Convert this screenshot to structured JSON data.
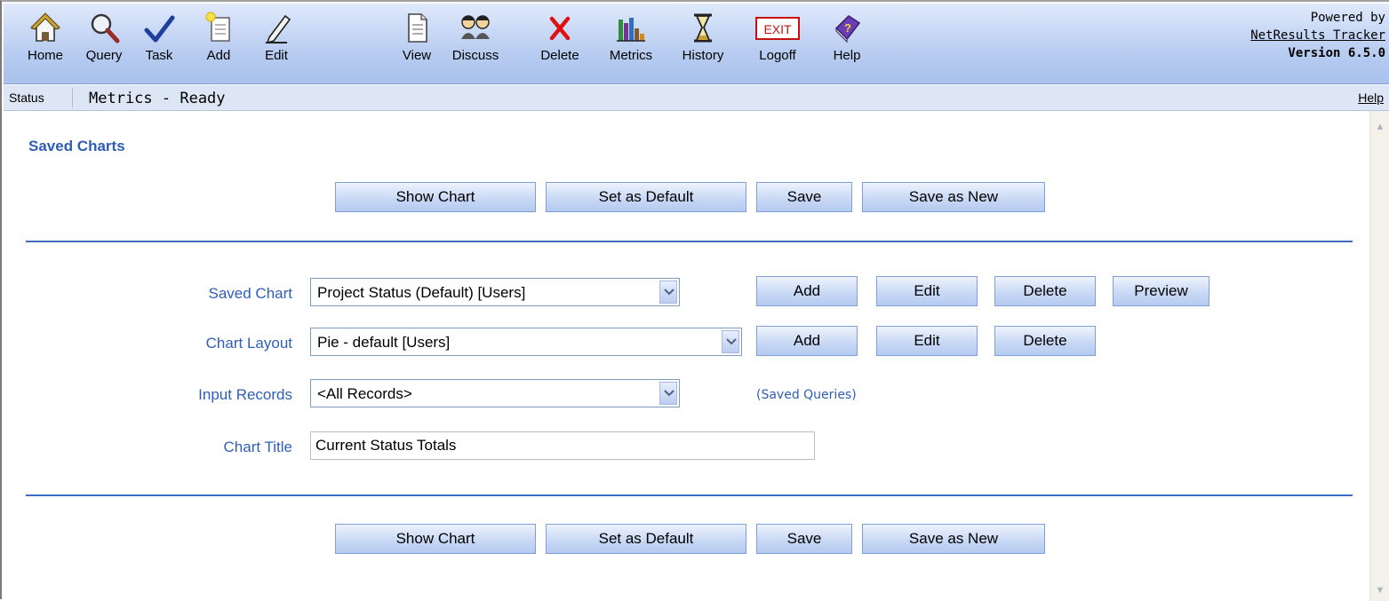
{
  "toolbar": {
    "items": [
      {
        "label": "Home",
        "icon": "home-icon"
      },
      {
        "label": "Query",
        "icon": "magnifier-icon"
      },
      {
        "label": "Task",
        "icon": "checkmark-icon"
      },
      {
        "label": "Add",
        "icon": "new-document-icon"
      },
      {
        "label": "Edit",
        "icon": "pencil-icon"
      },
      {
        "label": "View",
        "icon": "document-icon"
      },
      {
        "label": "Discuss",
        "icon": "people-icon"
      },
      {
        "label": "Delete",
        "icon": "red-x-icon"
      },
      {
        "label": "Metrics",
        "icon": "bar-chart-icon"
      },
      {
        "label": "History",
        "icon": "hourglass-icon"
      },
      {
        "label": "Logoff",
        "icon": "exit-sign-icon",
        "icon_text": "EXIT"
      },
      {
        "label": "Help",
        "icon": "help-book-icon",
        "icon_text": "?"
      }
    ],
    "powered_by": "Powered by",
    "product_link": "NetResults Tracker",
    "version": "Version 6.5.0"
  },
  "statusbar": {
    "label": "Status",
    "text": "Metrics - Ready",
    "help": "Help"
  },
  "main": {
    "section_title": "Saved Charts",
    "top_buttons": [
      "Show Chart",
      "Set as Default",
      "Save",
      "Save as New"
    ],
    "bottom_buttons": [
      "Show Chart",
      "Set as Default",
      "Save",
      "Save as New"
    ],
    "saved_chart": {
      "label": "Saved Chart",
      "value": "Project Status (Default) [Users]",
      "buttons": [
        "Add",
        "Edit",
        "Delete",
        "Preview"
      ]
    },
    "chart_layout": {
      "label": "Chart Layout",
      "value": "Pie - default [Users]",
      "buttons": [
        "Add",
        "Edit",
        "Delete"
      ]
    },
    "input_records": {
      "label": "Input Records",
      "value": "<All Records>",
      "link": "(Saved Queries)"
    },
    "chart_title": {
      "label": "Chart Title",
      "value": "Current Status Totals"
    }
  },
  "colors": {
    "accent": "#2e5eb8",
    "toolbar_bg": "#b9cdf1",
    "rule": "#3d6cc0",
    "button_bg": "#c9d9f5",
    "delete_red": "#e01010",
    "help_purple": "#6a3fb5"
  }
}
